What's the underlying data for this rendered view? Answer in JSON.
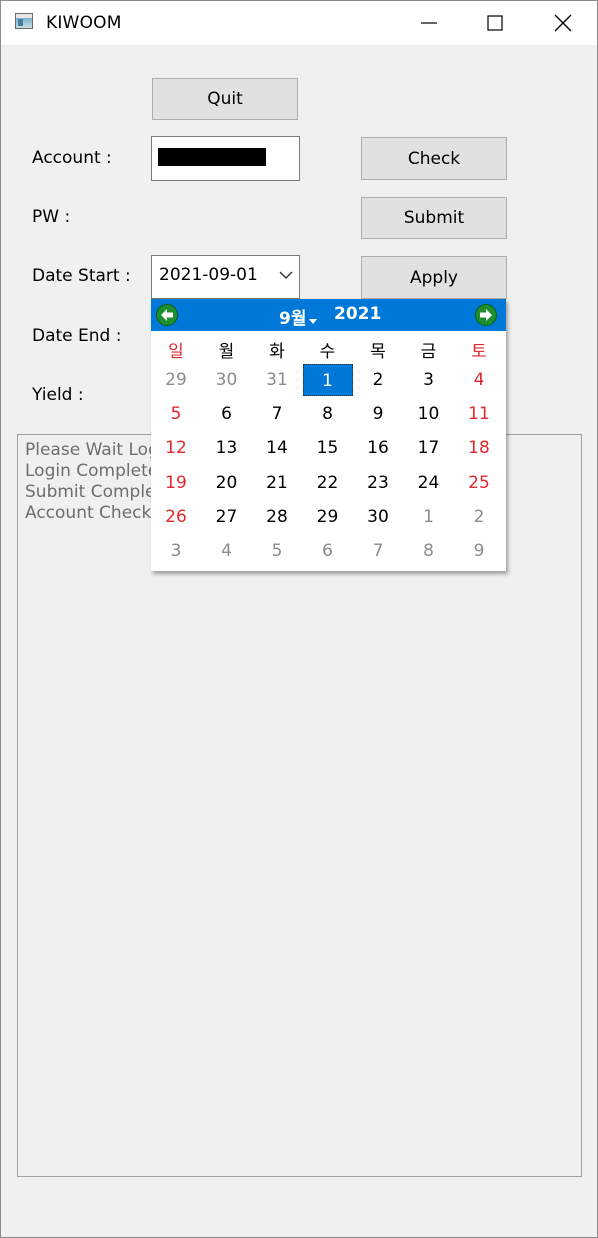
{
  "window": {
    "title": "KIWOOM"
  },
  "buttons": {
    "quit": "Quit",
    "check": "Check",
    "submit": "Submit",
    "apply": "Apply"
  },
  "labels": {
    "account": "Account :",
    "pw": "PW :",
    "date_start": "Date Start :",
    "date_end": "Date End :",
    "yield": "Yield :"
  },
  "date_start": {
    "value": "2021-09-01"
  },
  "log": {
    "lines": [
      "Please Wait Login...",
      "Login Complete",
      "Submit Complete",
      "Account Check"
    ]
  },
  "calendar": {
    "month": "9월",
    "year": "2021",
    "weekdays": [
      "일",
      "월",
      "화",
      "수",
      "목",
      "금",
      "토"
    ],
    "weeks": [
      [
        "29",
        "30",
        "31",
        "1",
        "2",
        "3",
        "4"
      ],
      [
        "5",
        "6",
        "7",
        "8",
        "9",
        "10",
        "11"
      ],
      [
        "12",
        "13",
        "14",
        "15",
        "16",
        "17",
        "18"
      ],
      [
        "19",
        "20",
        "21",
        "22",
        "23",
        "24",
        "25"
      ],
      [
        "26",
        "27",
        "28",
        "29",
        "30",
        "1",
        "2"
      ],
      [
        "3",
        "4",
        "5",
        "6",
        "7",
        "8",
        "9"
      ]
    ],
    "selected_day": "1"
  },
  "colors": {
    "accent": "#0078d7",
    "weekend": "#e0282e",
    "nav_button": "#1d8f2e"
  }
}
